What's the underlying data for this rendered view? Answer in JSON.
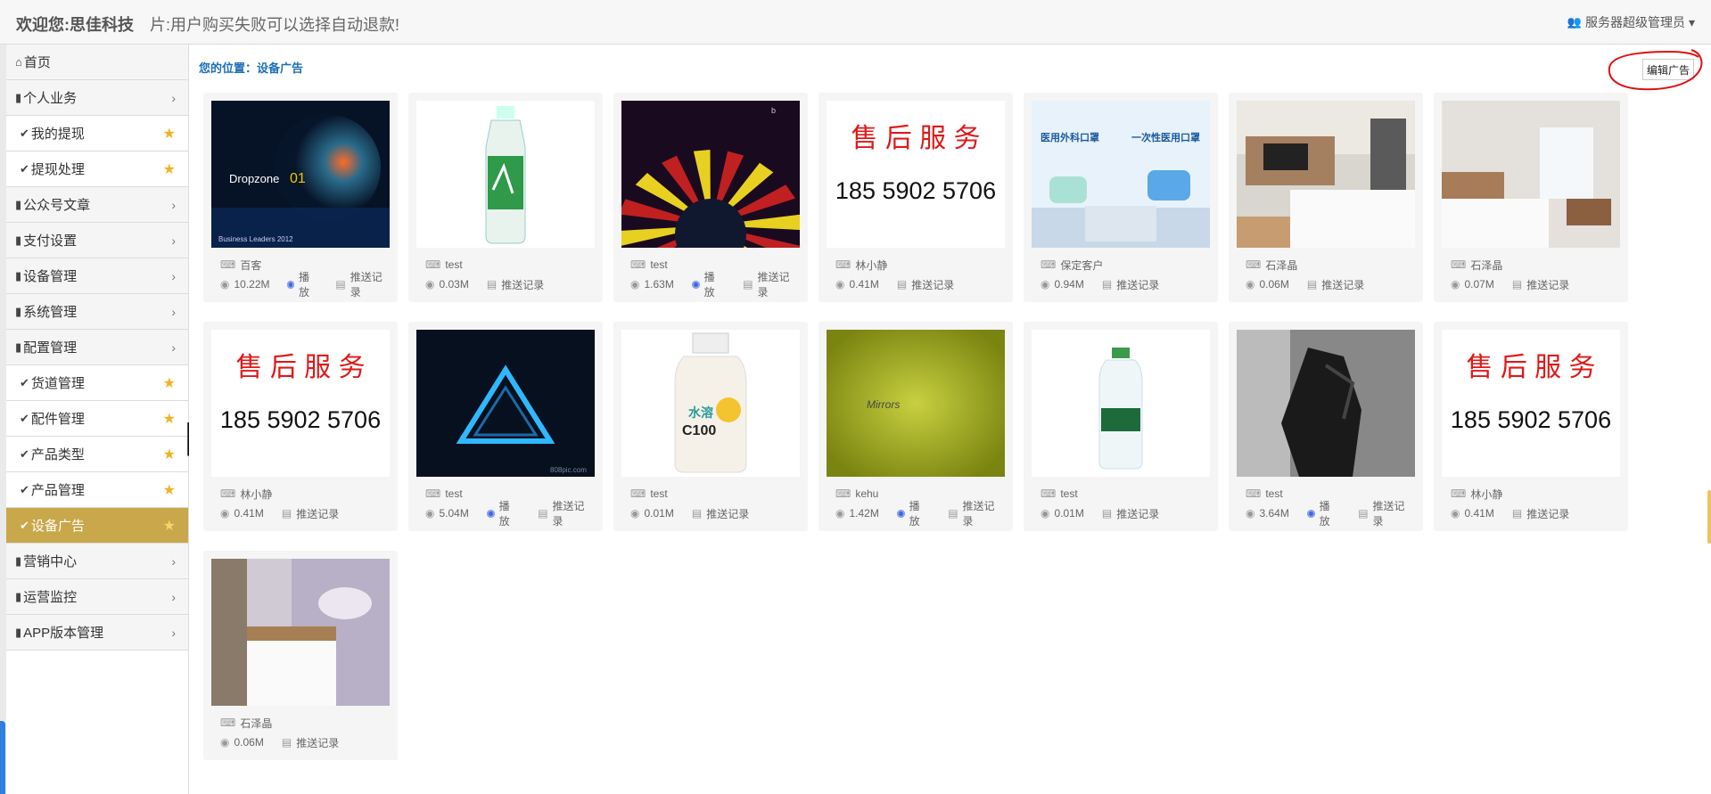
{
  "header": {
    "brand": "欢迎您:思佳科技",
    "marquee": "片:用户购买失败可以选择自动退款!",
    "user": "服务器超级管理员",
    "user_caret": "▾"
  },
  "sidebar": {
    "items": [
      {
        "label": "首页",
        "type": "top",
        "icon": "home-icon"
      },
      {
        "label": "个人业务",
        "type": "group",
        "icon": "file-icon"
      },
      {
        "label": "我的提现",
        "type": "sub",
        "icon": "check-icon"
      },
      {
        "label": "提现处理",
        "type": "sub",
        "icon": "check-icon"
      },
      {
        "label": "公众号文章",
        "type": "group",
        "icon": "file-icon"
      },
      {
        "label": "支付设置",
        "type": "group",
        "icon": "file-icon"
      },
      {
        "label": "设备管理",
        "type": "group",
        "icon": "file-icon"
      },
      {
        "label": "系统管理",
        "type": "group",
        "icon": "file-icon"
      },
      {
        "label": "配置管理",
        "type": "group",
        "icon": "file-icon"
      },
      {
        "label": "货道管理",
        "type": "sub",
        "icon": "check-icon"
      },
      {
        "label": "配件管理",
        "type": "sub",
        "icon": "check-icon"
      },
      {
        "label": "产品类型",
        "type": "sub",
        "icon": "check-icon"
      },
      {
        "label": "产品管理",
        "type": "sub",
        "icon": "check-icon"
      },
      {
        "label": "设备广告",
        "type": "sub",
        "icon": "check-icon",
        "active": true
      },
      {
        "label": "营销中心",
        "type": "group",
        "icon": "file-icon"
      },
      {
        "label": "运营监控",
        "type": "group",
        "icon": "file-icon"
      },
      {
        "label": "APP版本管理",
        "type": "group",
        "icon": "file-icon"
      }
    ]
  },
  "content": {
    "breadcrumb": "您的位置：设备广告",
    "edit_button": "编辑广告",
    "push_label": "推送记录",
    "play_label": "播放",
    "cards": [
      {
        "image": "dropzone",
        "owner": "百客",
        "size": "10.22M",
        "play": true
      },
      {
        "image": "bottle-green",
        "owner": "test",
        "size": "0.03M",
        "play": false
      },
      {
        "image": "kaleido",
        "owner": "test",
        "size": "1.63M",
        "play": true
      },
      {
        "image": "service",
        "owner": "林小静",
        "size": "0.41M",
        "play": false
      },
      {
        "image": "masks",
        "owner": "保定客户",
        "size": "0.94M",
        "play": false
      },
      {
        "image": "hotel1",
        "owner": "石泽晶",
        "size": "0.06M",
        "play": false
      },
      {
        "image": "hotel2",
        "owner": "石泽晶",
        "size": "0.07M",
        "play": false
      },
      {
        "image": "service",
        "owner": "林小静",
        "size": "0.41M",
        "play": false
      },
      {
        "image": "triangle",
        "owner": "test",
        "size": "5.04M",
        "play": true
      },
      {
        "image": "bottle-c100",
        "owner": "test",
        "size": "0.01M",
        "play": false
      },
      {
        "image": "mirrors",
        "owner": "kehu",
        "size": "1.42M",
        "play": true
      },
      {
        "image": "water",
        "owner": "test",
        "size": "0.01M",
        "play": false
      },
      {
        "image": "robot",
        "owner": "test",
        "size": "3.64M",
        "play": true
      },
      {
        "image": "service",
        "owner": "林小静",
        "size": "0.41M",
        "play": false
      },
      {
        "image": "hotel3",
        "owner": "石泽晶",
        "size": "0.06M",
        "play": false
      }
    ],
    "thumb_text": {
      "dropzone_title": "Dropzone",
      "dropzone_num": "01",
      "dropzone_sub": "Business Leaders 2012",
      "service_title": "售 后 服 务",
      "service_phone": "185  5902  5706",
      "mask_left": "医用外科口罩",
      "mask_right": "一次性医用口罩",
      "c100_brand": "水溶",
      "c100_name": "C100",
      "mirrors_text": "Mirrors",
      "watermark": "808pic.com"
    }
  }
}
